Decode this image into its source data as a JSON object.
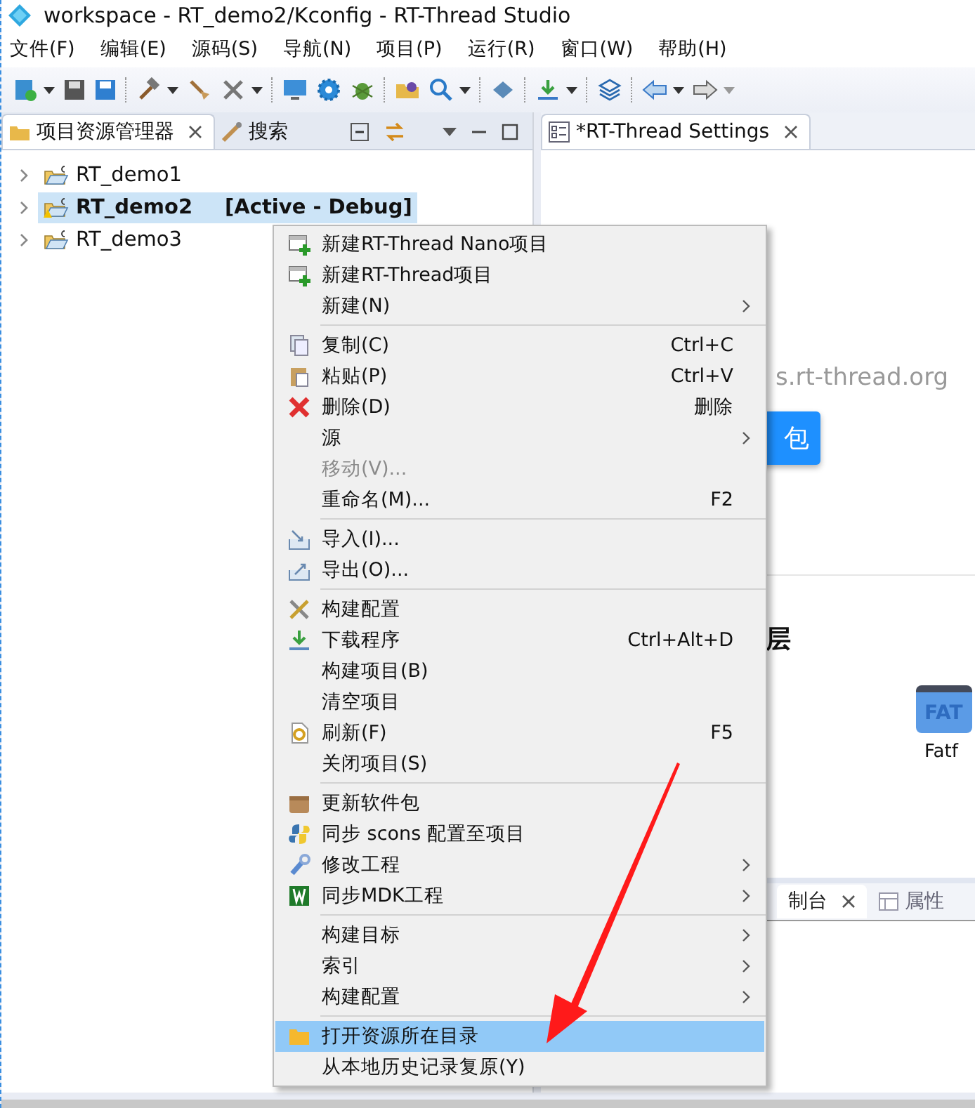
{
  "window": {
    "title": "workspace - RT_demo2/Kconfig - RT-Thread Studio"
  },
  "menu_bar": [
    "文件(F)",
    "编辑(E)",
    "源码(S)",
    "导航(N)",
    "项目(P)",
    "运行(R)",
    "窗口(W)",
    "帮助(H)"
  ],
  "left_panel": {
    "tabs": [
      {
        "label": "项目资源管理器",
        "selected": true
      },
      {
        "label": "搜索",
        "selected": false
      }
    ],
    "tree": [
      {
        "label": "RT_demo1",
        "selected": false,
        "expanded": false,
        "warning": false
      },
      {
        "label": "RT_demo2",
        "tag": "[Active - Debug]",
        "selected": true,
        "expanded": false,
        "warning": true
      },
      {
        "label": "RT_demo3",
        "selected": false,
        "expanded": false,
        "warning": false
      }
    ]
  },
  "editor": {
    "tabs": [
      {
        "label": "*RT-Thread Settings",
        "selected": true
      }
    ],
    "link_text": "s.rt-thread.org",
    "button": "包",
    "heading": "层",
    "package_icon_text": "FAT",
    "package_label": "Fatf",
    "bottom_tabs": [
      {
        "label": "制台",
        "selected": true
      },
      {
        "label": "属性",
        "selected": false
      }
    ]
  },
  "context_menu": [
    {
      "kind": "item",
      "label": "新建RT-Thread Nano项目",
      "submenu": false,
      "disabled": false,
      "selected": false
    },
    {
      "kind": "item",
      "label": "新建RT-Thread项目",
      "submenu": false,
      "disabled": false,
      "selected": false
    },
    {
      "kind": "item",
      "label": "新建(N)",
      "submenu": true,
      "disabled": false,
      "selected": false
    },
    {
      "kind": "separator"
    },
    {
      "kind": "item",
      "label": "复制(C)",
      "shortcut": "Ctrl+C",
      "submenu": false,
      "disabled": false,
      "selected": false
    },
    {
      "kind": "item",
      "label": "粘贴(P)",
      "shortcut": "Ctrl+V",
      "submenu": false,
      "disabled": false,
      "selected": false
    },
    {
      "kind": "item",
      "label": "删除(D)",
      "shortcut": "删除",
      "submenu": false,
      "disabled": false,
      "selected": false
    },
    {
      "kind": "item",
      "label": "源",
      "submenu": true,
      "disabled": false,
      "selected": false
    },
    {
      "kind": "item",
      "label": "移动(V)...",
      "submenu": false,
      "disabled": true,
      "selected": false
    },
    {
      "kind": "item",
      "label": "重命名(M)...",
      "shortcut": "F2",
      "submenu": false,
      "disabled": false,
      "selected": false
    },
    {
      "kind": "separator"
    },
    {
      "kind": "item",
      "label": "导入(I)...",
      "submenu": false,
      "disabled": false,
      "selected": false
    },
    {
      "kind": "item",
      "label": "导出(O)...",
      "submenu": false,
      "disabled": false,
      "selected": false
    },
    {
      "kind": "separator"
    },
    {
      "kind": "item",
      "label": "构建配置",
      "submenu": false,
      "disabled": false,
      "selected": false
    },
    {
      "kind": "item",
      "label": "下载程序",
      "shortcut": "Ctrl+Alt+D",
      "submenu": false,
      "disabled": false,
      "selected": false
    },
    {
      "kind": "item",
      "label": "构建项目(B)",
      "submenu": false,
      "disabled": false,
      "selected": false
    },
    {
      "kind": "item",
      "label": "清空项目",
      "submenu": false,
      "disabled": false,
      "selected": false
    },
    {
      "kind": "item",
      "label": "刷新(F)",
      "shortcut": "F5",
      "submenu": false,
      "disabled": false,
      "selected": false
    },
    {
      "kind": "item",
      "label": "关闭项目(S)",
      "submenu": false,
      "disabled": false,
      "selected": false
    },
    {
      "kind": "separator"
    },
    {
      "kind": "item",
      "label": "更新软件包",
      "submenu": false,
      "disabled": false,
      "selected": false
    },
    {
      "kind": "item",
      "label": "同步 scons 配置至项目",
      "submenu": false,
      "disabled": false,
      "selected": false
    },
    {
      "kind": "item",
      "label": "修改工程",
      "submenu": true,
      "disabled": false,
      "selected": false
    },
    {
      "kind": "item",
      "label": "同步MDK工程",
      "submenu": true,
      "disabled": false,
      "selected": false
    },
    {
      "kind": "separator"
    },
    {
      "kind": "item",
      "label": "构建目标",
      "submenu": true,
      "disabled": false,
      "selected": false
    },
    {
      "kind": "item",
      "label": "索引",
      "submenu": true,
      "disabled": false,
      "selected": false
    },
    {
      "kind": "item",
      "label": "构建配置",
      "submenu": true,
      "disabled": false,
      "selected": false
    },
    {
      "kind": "separator"
    },
    {
      "kind": "item",
      "label": "打开资源所在目录",
      "submenu": false,
      "disabled": false,
      "selected": true
    },
    {
      "kind": "item",
      "label": "从本地历史记录复原(Y)",
      "submenu": false,
      "disabled": false,
      "selected": false
    }
  ],
  "annotation": {
    "kind": "arrow",
    "color": "#ff1a1a"
  }
}
